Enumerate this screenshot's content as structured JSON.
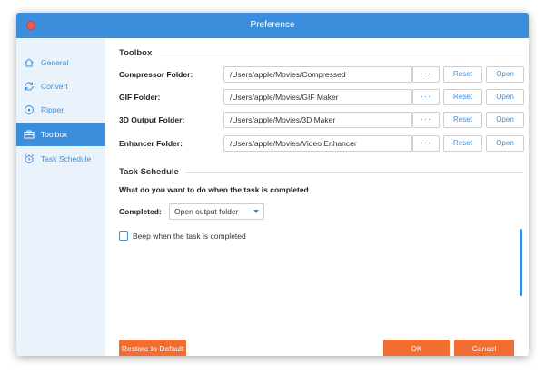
{
  "window": {
    "title": "Preference"
  },
  "sidebar": {
    "items": [
      {
        "label": "General",
        "icon": "home-icon",
        "active": false
      },
      {
        "label": "Convert",
        "icon": "refresh-icon",
        "active": false
      },
      {
        "label": "Ripper",
        "icon": "disc-icon",
        "active": false
      },
      {
        "label": "Toolbox",
        "icon": "toolbox-icon",
        "active": true
      },
      {
        "label": "Task Schedule",
        "icon": "alarm-clock-icon",
        "active": false
      }
    ]
  },
  "toolbox": {
    "title": "Toolbox",
    "rows": [
      {
        "label": "Compressor Folder:",
        "path": "/Users/apple/Movies/Compressed",
        "browse": "···",
        "reset": "Reset",
        "open": "Open"
      },
      {
        "label": "GIF Folder:",
        "path": "/Users/apple/Movies/GIF Maker",
        "browse": "···",
        "reset": "Reset",
        "open": "Open"
      },
      {
        "label": "3D Output Folder:",
        "path": "/Users/apple/Movies/3D Maker",
        "browse": "···",
        "reset": "Reset",
        "open": "Open"
      },
      {
        "label": "Enhancer Folder:",
        "path": "/Users/apple/Movies/Video Enhancer",
        "browse": "···",
        "reset": "Reset",
        "open": "Open"
      }
    ]
  },
  "task_schedule": {
    "title": "Task Schedule",
    "question": "What do you want to do when the task is completed",
    "completed_label": "Completed:",
    "completed_value": "Open output folder",
    "beep_label": "Beep when the task is completed",
    "beep_checked": false
  },
  "footer": {
    "restore_label": "Restore to Default",
    "ok_label": "OK",
    "cancel_label": "Cancel"
  },
  "colors": {
    "accent": "#3b8edb",
    "orange": "#f26d32",
    "sidebar_bg": "#eaf3fc"
  }
}
